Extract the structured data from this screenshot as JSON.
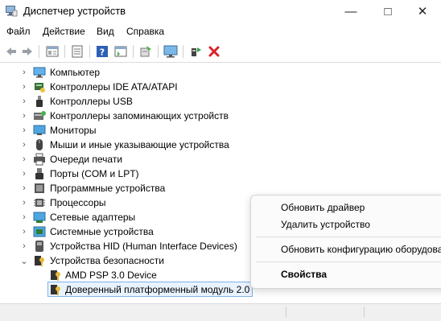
{
  "window": {
    "title": "Диспетчер устройств"
  },
  "menu": [
    "Файл",
    "Действие",
    "Вид",
    "Справка"
  ],
  "toolbar_icons": [
    "back-arrow-icon",
    "forward-arrow-icon",
    "properties-icon",
    "list-icon",
    "help-icon",
    "details-icon",
    "update-icon",
    "monitor-icon",
    "enable-device-icon",
    "uninstall-x-icon"
  ],
  "tree": {
    "categories": [
      {
        "label": "Компьютер",
        "icon": "computer-icon"
      },
      {
        "label": "Контроллеры IDE ATA/ATAPI",
        "icon": "ide-icon"
      },
      {
        "label": "Контроллеры USB",
        "icon": "usb-icon"
      },
      {
        "label": "Контроллеры запоминающих устройств",
        "icon": "storage-icon"
      },
      {
        "label": "Мониторы",
        "icon": "monitor-icon"
      },
      {
        "label": "Мыши и иные указывающие устройства",
        "icon": "mouse-icon"
      },
      {
        "label": "Очереди печати",
        "icon": "printer-icon"
      },
      {
        "label": "Порты (COM и LPT)",
        "icon": "port-icon"
      },
      {
        "label": "Программные устройства",
        "icon": "software-device-icon"
      },
      {
        "label": "Процессоры",
        "icon": "processor-icon"
      },
      {
        "label": "Сетевые адаптеры",
        "icon": "network-adapter-icon"
      },
      {
        "label": "Системные устройства",
        "icon": "system-device-icon"
      },
      {
        "label": "Устройства HID (Human Interface Devices)",
        "icon": "hid-icon"
      },
      {
        "label": "Устройства безопасности",
        "icon": "security-device-icon"
      }
    ],
    "children": [
      {
        "label": "AMD PSP 3.0 Device",
        "icon": "security-device-icon"
      },
      {
        "label": "Доверенный платформенный модуль 2.0",
        "icon": "security-device-icon"
      }
    ]
  },
  "context_menu": {
    "update_driver": "Обновить драйвер",
    "uninstall": "Удалить устройство",
    "scan": "Обновить конфигурацию оборудования",
    "properties": "Свойства"
  },
  "colors": {
    "selection": "#e9f3ff",
    "selection_border": "#7fb2e5",
    "delete_red": "#d9242b"
  }
}
